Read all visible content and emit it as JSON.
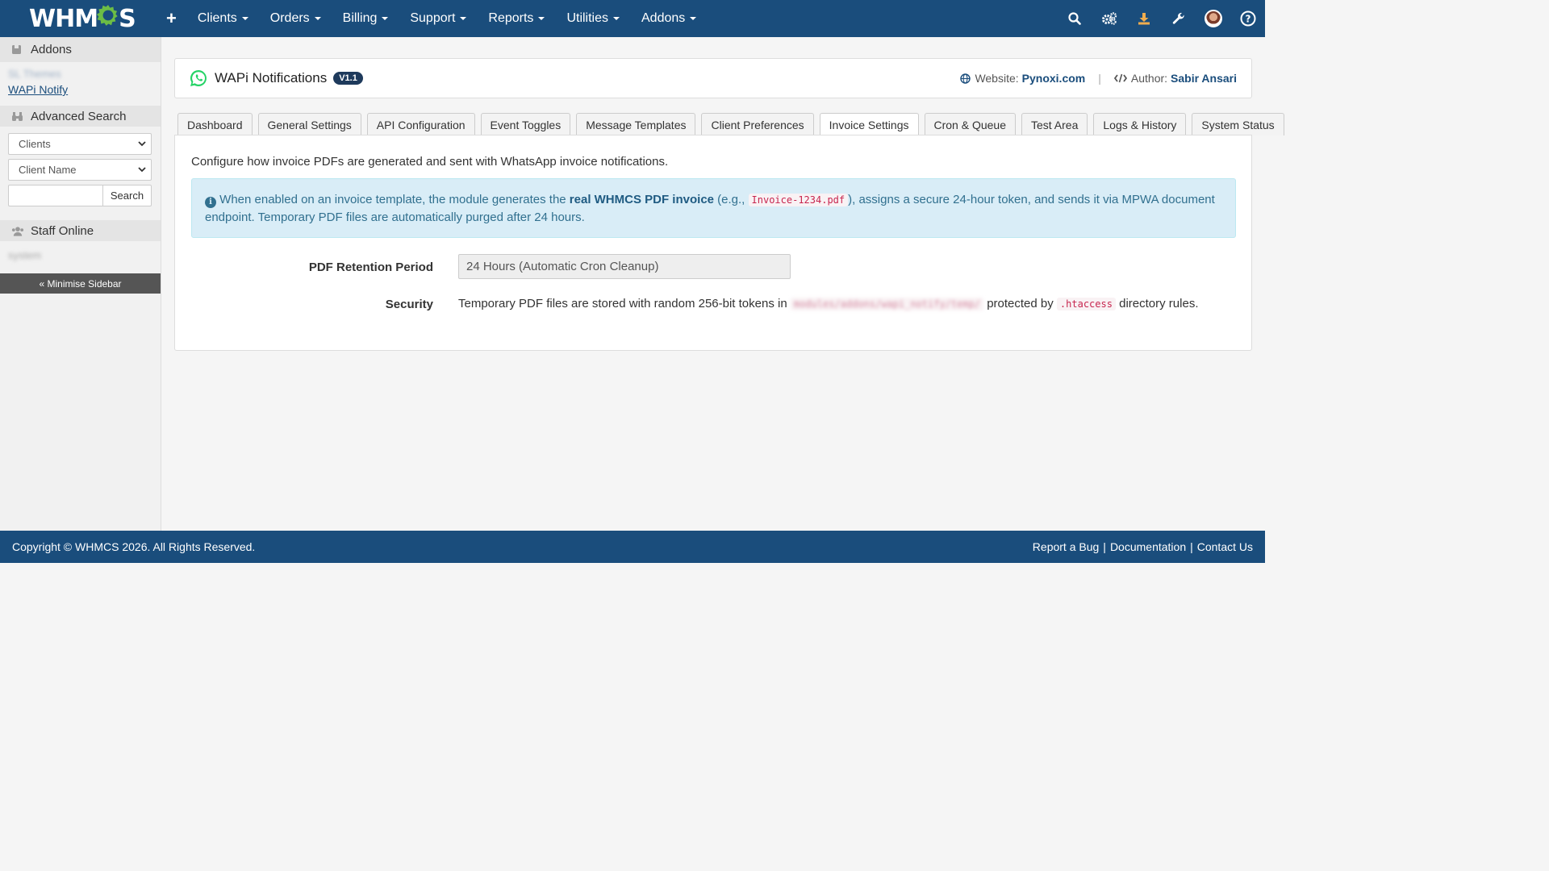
{
  "brand": {
    "logo_text_left": "WHM",
    "logo_text_right": "S"
  },
  "nav": {
    "items": [
      {
        "label": "Clients"
      },
      {
        "label": "Orders"
      },
      {
        "label": "Billing"
      },
      {
        "label": "Support"
      },
      {
        "label": "Reports"
      },
      {
        "label": "Utilities"
      },
      {
        "label": "Addons"
      }
    ],
    "right_icons": [
      "search-icon",
      "gears-icon",
      "download-icon",
      "wrench-icon",
      "avatar",
      "help-icon"
    ]
  },
  "sidebar": {
    "addons": {
      "title": "Addons",
      "blurred_item": "SL Themes",
      "link": "WAPi Notify"
    },
    "search": {
      "title": "Advanced Search",
      "type_select": "Clients",
      "field_select": "Client Name",
      "button": "Search"
    },
    "staff": {
      "title": "Staff Online",
      "blurred_item": "system"
    },
    "minimise": "« Minimise Sidebar"
  },
  "module": {
    "title": "WAPi Notifications",
    "version": "V1.1",
    "website_label": "Website:",
    "website": "Pynoxi.com",
    "author_label": "Author:",
    "author": "Sabir Ansari"
  },
  "tabs": [
    {
      "label": "Dashboard",
      "active": false
    },
    {
      "label": "General Settings",
      "active": false
    },
    {
      "label": "API Configuration",
      "active": false
    },
    {
      "label": "Event Toggles",
      "active": false
    },
    {
      "label": "Message Templates",
      "active": false
    },
    {
      "label": "Client Preferences",
      "active": false
    },
    {
      "label": "Invoice Settings",
      "active": true
    },
    {
      "label": "Cron & Queue",
      "active": false
    },
    {
      "label": "Test Area",
      "active": false
    },
    {
      "label": "Logs & History",
      "active": false
    },
    {
      "label": "System Status",
      "active": false
    }
  ],
  "invoice_settings": {
    "intro": "Configure how invoice PDFs are generated and sent with WhatsApp invoice notifications.",
    "alert": {
      "part1": "When enabled on an invoice template, the module generates the ",
      "bold": "real WHMCS PDF invoice",
      "part2": " (e.g., ",
      "code": "Invoice-1234.pdf",
      "part3": "), assigns a secure 24-hour token, and sends it via MPWA document endpoint. Temporary PDF files are automatically purged after 24 hours."
    },
    "retention_label": "PDF Retention Period",
    "retention_value": "24 Hours (Automatic Cron Cleanup)",
    "security_label": "Security",
    "security_text1": "Temporary PDF files are stored with random 256-bit tokens in ",
    "security_path": "modules/addons/wapi_notify/temp/",
    "security_text2": " protected by ",
    "security_code": ".htaccess",
    "security_text3": " directory rules."
  },
  "footer": {
    "copyright": "Copyright © WHMCS 2026. All Rights Reserved.",
    "links": [
      "Report a Bug",
      "Documentation",
      "Contact Us"
    ]
  },
  "colors": {
    "nav_bg": "#1a4d7c",
    "accent_green": "#6cbd45",
    "alert_bg": "#d9edf7",
    "alert_text": "#31708f"
  }
}
